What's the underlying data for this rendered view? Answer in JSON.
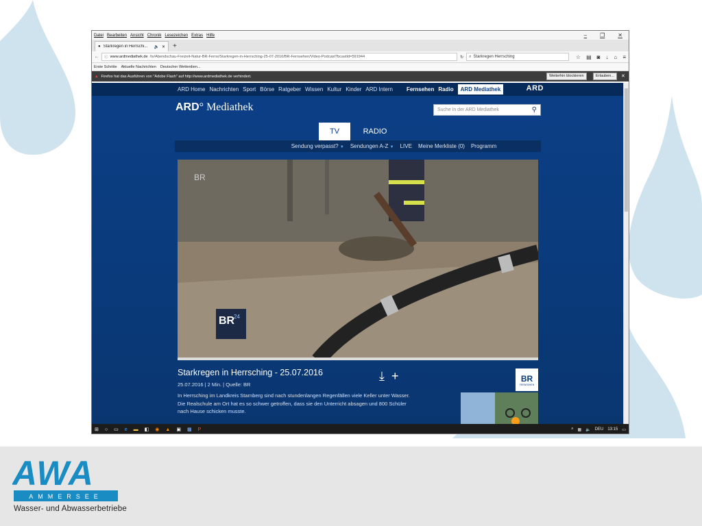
{
  "browser": {
    "menu": [
      "Datei",
      "Bearbeiten",
      "Ansicht",
      "Chronik",
      "Lesezeichen",
      "Extras",
      "Hilfe"
    ],
    "window_controls": {
      "minimize": "–",
      "restore": "❐",
      "close": "✕"
    },
    "tab": {
      "title": "Starkregen in Herrschi...",
      "audio_icon": "speaker-icon",
      "close": "✕"
    },
    "new_tab": "+",
    "url_host": "www.ardmediathek.de",
    "url_path": "/tv/Abendschau-Freizeit-Natur-BR-Ferns/Starkregen-in-Herrsching-25-07-2016/BR-Fernsehen/Video-Podcast?bcastId=591944",
    "search_value": "Starkregen Herrsching",
    "bookmarks": [
      "Erste Schritte",
      "Aktuelle Nachrichten",
      "Deutscher Wetterdien..."
    ],
    "flash_notice": "Firefox hat das Ausführen von \"Adobe Flash\" auf http://www.ardmediathek.de verhindert.",
    "flash_buttons": {
      "block": "Weiterhin blockieren",
      "allow": "Erlauben...",
      "close": "✕"
    }
  },
  "site": {
    "topnav": [
      "ARD Home",
      "Nachrichten",
      "Sport",
      "Börse",
      "Ratgeber",
      "Wissen",
      "Kultur",
      "Kinder",
      "ARD Intern"
    ],
    "topnav_right": [
      "Fernsehen",
      "Radio"
    ],
    "topnav_active": "ARD Mediathek",
    "ard_logo": "ARD",
    "logo_ard": "ARD",
    "logo_mediathek": "Mediathek",
    "search_placeholder": "Suche in der ARD Mediathek",
    "tabs": {
      "tv": "TV",
      "radio": "RADIO"
    },
    "subnav": [
      "Sendung verpasst?",
      "Sendungen A-Z",
      "LIVE",
      "Meine Merkliste (0)",
      "Programm"
    ],
    "video_logo_top": "BR",
    "video_logo_badge": "BR",
    "video_logo_badge_num": "24",
    "video": {
      "title": "Starkregen in Herrsching - 25.07.2016",
      "meta": "25.07.2016 | 2 Min. | Quelle: BR",
      "description": "In Herrsching im Landkreis Starnberg sind nach stundenlangen Regenfällen viele Keller unter Wasser. Die Realschule am Ort hat es so schwer getroffen, dass sie den Unterricht absagen und 800 Schüler nach Hause schicken musste."
    },
    "br_box": {
      "logo": "BR",
      "sub": "FERNSEHEN"
    }
  },
  "taskbar": {
    "lang": "DEU",
    "time": "13:15"
  },
  "footer": {
    "logo_main": "AWA",
    "logo_band": "AMMERSEE",
    "logo_sub": "Wasser- und Abwasserbetriebe"
  },
  "colors": {
    "brand_blue": "#1a8cc4",
    "ard_blue": "#0b3f86",
    "drop": "#cfe3ef"
  }
}
